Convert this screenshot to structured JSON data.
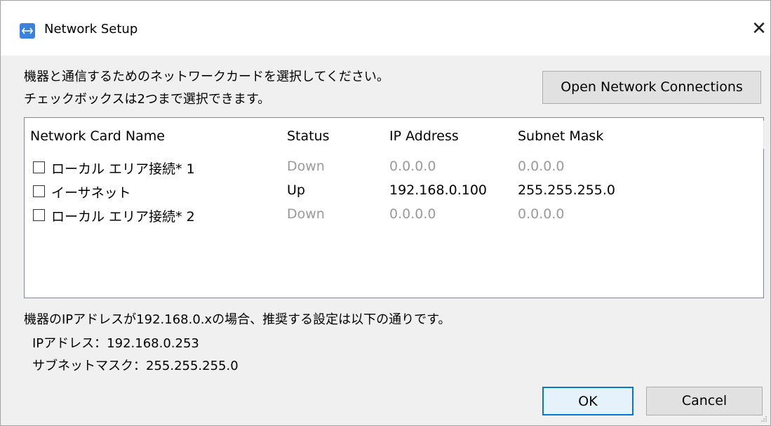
{
  "window": {
    "title": "Network Setup",
    "close_glyph": "✕"
  },
  "instructions": {
    "line1": "機器と通信するためのネットワークカードを選択してください。",
    "line2": "チェックボックスは2つまで選択できます。"
  },
  "open_network_connections_label": "Open Network Connections",
  "table": {
    "headers": [
      "Network Card Name",
      "Status",
      "IP Address",
      "Subnet Mask"
    ],
    "rows": [
      {
        "name": "ローカル エリア接続* 1",
        "status": "Down",
        "ip": "0.0.0.0",
        "mask": "0.0.0.0",
        "checked": false
      },
      {
        "name": "イーサネット",
        "status": "Up",
        "ip": "192.168.0.100",
        "mask": "255.255.255.0",
        "checked": false
      },
      {
        "name": "ローカル エリア接続* 2",
        "status": "Down",
        "ip": "0.0.0.0",
        "mask": "0.0.0.0",
        "checked": false
      }
    ]
  },
  "recommendation": {
    "line1": "機器のIPアドレスが192.168.0.xの場合、推奨する設定は以下の通りです。",
    "ip_line": "IPアドレス：192.168.0.253",
    "mask_line": "サブネットマスク：255.255.255.0"
  },
  "buttons": {
    "ok": "OK",
    "cancel": "Cancel"
  },
  "colors": {
    "icon_blue": "#3c82dc",
    "disabled_text": "#9a9a9a",
    "ok_border": "#0078d7"
  },
  "icons": {
    "app": "network-setup-icon",
    "close": "close-icon"
  }
}
